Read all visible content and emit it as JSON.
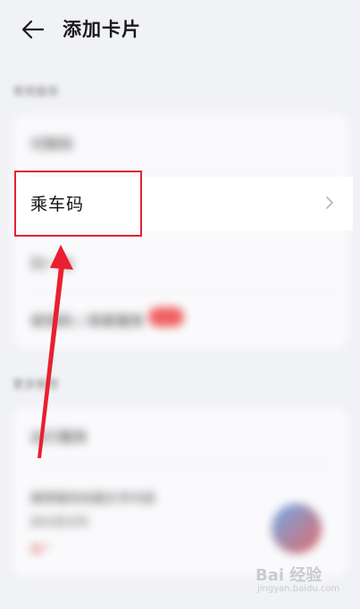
{
  "header": {
    "title": "添加卡片",
    "back_icon": "arrow-left-icon"
  },
  "section1": {
    "label": "常用服务"
  },
  "rows": [
    {
      "label": "付款码"
    },
    {
      "label": "乘车码"
    },
    {
      "label": "扫一扫"
    },
    {
      "label": "收钱码 / 商家服务"
    }
  ],
  "focus_row": {
    "label": "乘车码",
    "chevron_icon": "chevron-right-icon"
  },
  "section2": {
    "label": "更多推荐"
  },
  "card2": {
    "row1": "出行服务",
    "promo_title": "推荐服务标题文字内容",
    "promo_subtitle": "副标题说明",
    "promo_tag": "推广"
  },
  "watermark": {
    "text": "Bai 经验",
    "sub": "jingyan.baidu.com"
  },
  "colors": {
    "highlight": "#e02433",
    "arrow": "#e8202f",
    "background": "#f1f2f6"
  }
}
